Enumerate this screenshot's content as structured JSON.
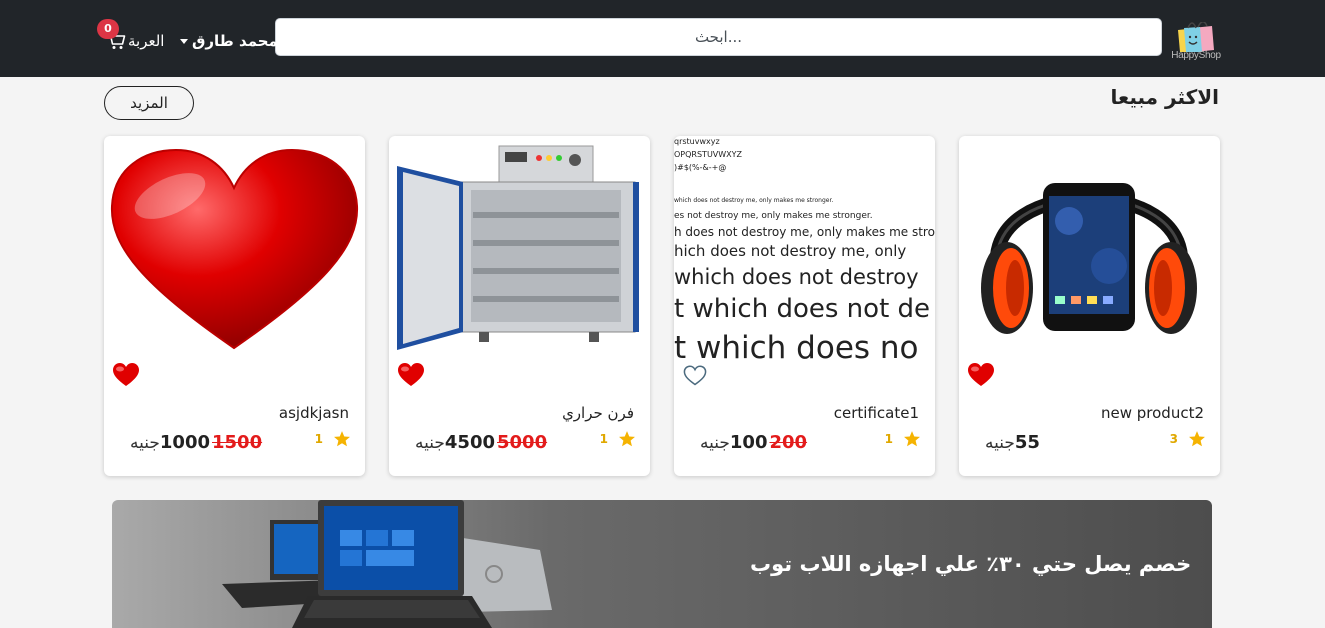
{
  "header": {
    "logo_text": "HappyShop",
    "search_placeholder": "ابحث...",
    "user_name": "محمد طارق",
    "cart_label": "العربة",
    "cart_count": "0"
  },
  "section": {
    "title": "الاكثر مبيعا",
    "more_label": "المزيد"
  },
  "products": [
    {
      "name": "new product2",
      "rating_count": "3",
      "price": "55",
      "old_price": "",
      "currency": "جنيه",
      "favorited": true,
      "image": "headphones-phone"
    },
    {
      "name": "certificate1",
      "rating_count": "1",
      "price": "100",
      "old_price": "200",
      "currency": "جنيه",
      "favorited": false,
      "image": "font-specimen",
      "specimen_lines": [
        "qrstuvwxyz",
        "OPQRSTUVWXYZ",
        ")#$(%-&-+@",
        "which does not destroy me, only makes me stronger.",
        "es not destroy me, only makes me stronger.",
        "h does not destroy me, only makes me strong",
        "hich does not destroy me, only",
        "which does not destroy",
        "t which does not de",
        "t which does no"
      ]
    },
    {
      "name": "فرن حراري",
      "rating_count": "1",
      "price": "4500",
      "old_price": "5000",
      "currency": "جنيه",
      "favorited": true,
      "image": "oven"
    },
    {
      "name": "asjdkjasn",
      "rating_count": "1",
      "price": "1000",
      "old_price": "1500",
      "currency": "جنيه",
      "favorited": true,
      "image": "red-heart"
    }
  ],
  "banner": {
    "text": "خصم يصل حتي ٣٠٪ علي اجهازه اللاب توب"
  },
  "colors": {
    "header_bg": "#212529",
    "badge_red": "#dc3545",
    "old_price_red": "#e31b1b",
    "star_gold": "#f5b301",
    "heart_red": "#e00000"
  }
}
